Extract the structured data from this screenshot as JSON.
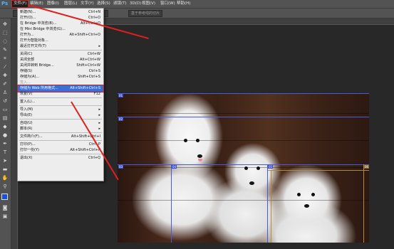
{
  "app": {
    "logo": "Ps"
  },
  "menubar": [
    "文件(F)",
    "编辑(E)",
    "图像(I)",
    "图层(L)",
    "文字(Y)",
    "选择(S)",
    "滤镜(T)",
    "3D(D)",
    "视图(V)",
    "窗口(W)",
    "帮助(H)"
  ],
  "optionsbar": {
    "slice_button": "基于参考线的切片"
  },
  "file_menu": [
    {
      "label": "新建(N)...",
      "shortcut": "Ctrl+N"
    },
    {
      "label": "打开(O)...",
      "shortcut": "Ctrl+O"
    },
    {
      "label": "在 Bridge 中浏览(B)...",
      "shortcut": "Alt+Ctrl+O"
    },
    {
      "label": "在 Mini Bridge 中浏览(G)...",
      "shortcut": ""
    },
    {
      "label": "打开为...",
      "shortcut": "Alt+Shift+Ctrl+O"
    },
    {
      "label": "打开为智能对象...",
      "shortcut": ""
    },
    {
      "label": "最近打开文件(T)",
      "shortcut": "",
      "submenu": true
    },
    {
      "sep": true
    },
    {
      "label": "关闭(C)",
      "shortcut": "Ctrl+W"
    },
    {
      "label": "关闭全部",
      "shortcut": "Alt+Ctrl+W"
    },
    {
      "label": "关闭并转到 Bridge...",
      "shortcut": "Shift+Ctrl+W"
    },
    {
      "label": "存储(S)",
      "shortcut": "Ctrl+S"
    },
    {
      "label": "存储为(A)...",
      "shortcut": "Shift+Ctrl+S"
    },
    {
      "label": "签入...",
      "shortcut": "",
      "disabled": true
    },
    {
      "label": "存储为 Web 所用格式...",
      "shortcut": "Alt+Shift+Ctrl+S",
      "highlight": true
    },
    {
      "label": "恢复(V)",
      "shortcut": "F12"
    },
    {
      "sep": true
    },
    {
      "label": "置入(L)...",
      "shortcut": ""
    },
    {
      "sep": true
    },
    {
      "label": "导入(M)",
      "shortcut": "",
      "submenu": true
    },
    {
      "label": "导出(E)",
      "shortcut": "",
      "submenu": true
    },
    {
      "sep": true
    },
    {
      "label": "自动(U)",
      "shortcut": "",
      "submenu": true
    },
    {
      "label": "脚本(R)",
      "shortcut": "",
      "submenu": true
    },
    {
      "sep": true
    },
    {
      "label": "文件简介(F)...",
      "shortcut": "Alt+Shift+Ctrl+I"
    },
    {
      "sep": true
    },
    {
      "label": "打印(P)...",
      "shortcut": "Ctrl+P"
    },
    {
      "label": "打印一份(Y)",
      "shortcut": "Alt+Shift+Ctrl+P"
    },
    {
      "sep": true
    },
    {
      "label": "退出(X)",
      "shortcut": "Ctrl+Q"
    }
  ],
  "slices": [
    {
      "tag": "01"
    },
    {
      "tag": "02"
    },
    {
      "tag": "03"
    },
    {
      "tag": "04"
    },
    {
      "tag": "05"
    },
    {
      "tag": "06"
    }
  ],
  "colors": {
    "accent": "#3a6fd8",
    "annotation": "#e02020",
    "slice": "#4a5bd8"
  }
}
